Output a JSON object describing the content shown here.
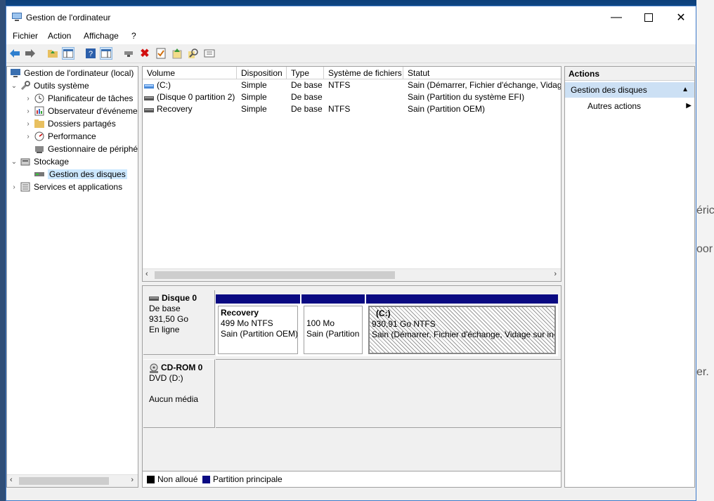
{
  "window": {
    "title": "Gestion de l'ordinateur"
  },
  "menu": [
    "Fichier",
    "Action",
    "Affichage",
    "?"
  ],
  "toolbar": {
    "icons": [
      "back-arrow-icon",
      "forward-arrow-icon",
      "up-folder-icon",
      "show-hide-tree-icon",
      "help-icon",
      "show-hide-action-icon",
      "connect-drive-icon",
      "delete-icon",
      "properties-icon",
      "refresh-icon",
      "search-icon",
      "export-list-icon"
    ]
  },
  "tree": {
    "root": "Gestion de l'ordinateur (local)",
    "system_tools": "Outils système",
    "task_scheduler": "Planificateur de tâches",
    "event_viewer": "Observateur d'événeme",
    "shared_folders": "Dossiers partagés",
    "performance": "Performance",
    "device_manager": "Gestionnaire de périphé",
    "storage": "Stockage",
    "disk_management": "Gestion des disques",
    "services": "Services et applications"
  },
  "volumes": {
    "columns": [
      "Volume",
      "Disposition",
      "Type",
      "Système de fichiers",
      "Statut"
    ],
    "rows": [
      [
        "(C:)",
        "Simple",
        "De base",
        "NTFS",
        "Sain (Démarrer, Fichier d'échange, Vidage"
      ],
      [
        "(Disque 0 partition 2)",
        "Simple",
        "De base",
        "",
        "Sain (Partition du système EFI)"
      ],
      [
        "Recovery",
        "Simple",
        "De base",
        "NTFS",
        "Sain (Partition OEM)"
      ]
    ]
  },
  "disk0": {
    "name": "Disque 0",
    "type": "De base",
    "size": "931,50 Go",
    "state": "En ligne",
    "partitions": [
      {
        "name": "Recovery",
        "size": "499 Mo NTFS",
        "status": "Sain (Partition OEM)"
      },
      {
        "name": "",
        "size": "100 Mo",
        "status": "Sain (Partition"
      },
      {
        "name": "(C:)",
        "size": "930,91 Go NTFS",
        "status": "Sain (Démarrer, Fichier d'échange, Vidage sur inc"
      }
    ]
  },
  "cdrom0": {
    "name": "CD-ROM 0",
    "drive": "DVD (D:)",
    "media": "Aucun média"
  },
  "legend": {
    "unallocated": "Non alloué",
    "primary": "Partition principale",
    "unallocated_color": "#000000",
    "primary_color": "#0a0a82"
  },
  "actions": {
    "title": "Actions",
    "section": "Gestion des disques",
    "more": "Autres actions"
  },
  "background_fragments": [
    "éric",
    "oor",
    "er."
  ]
}
